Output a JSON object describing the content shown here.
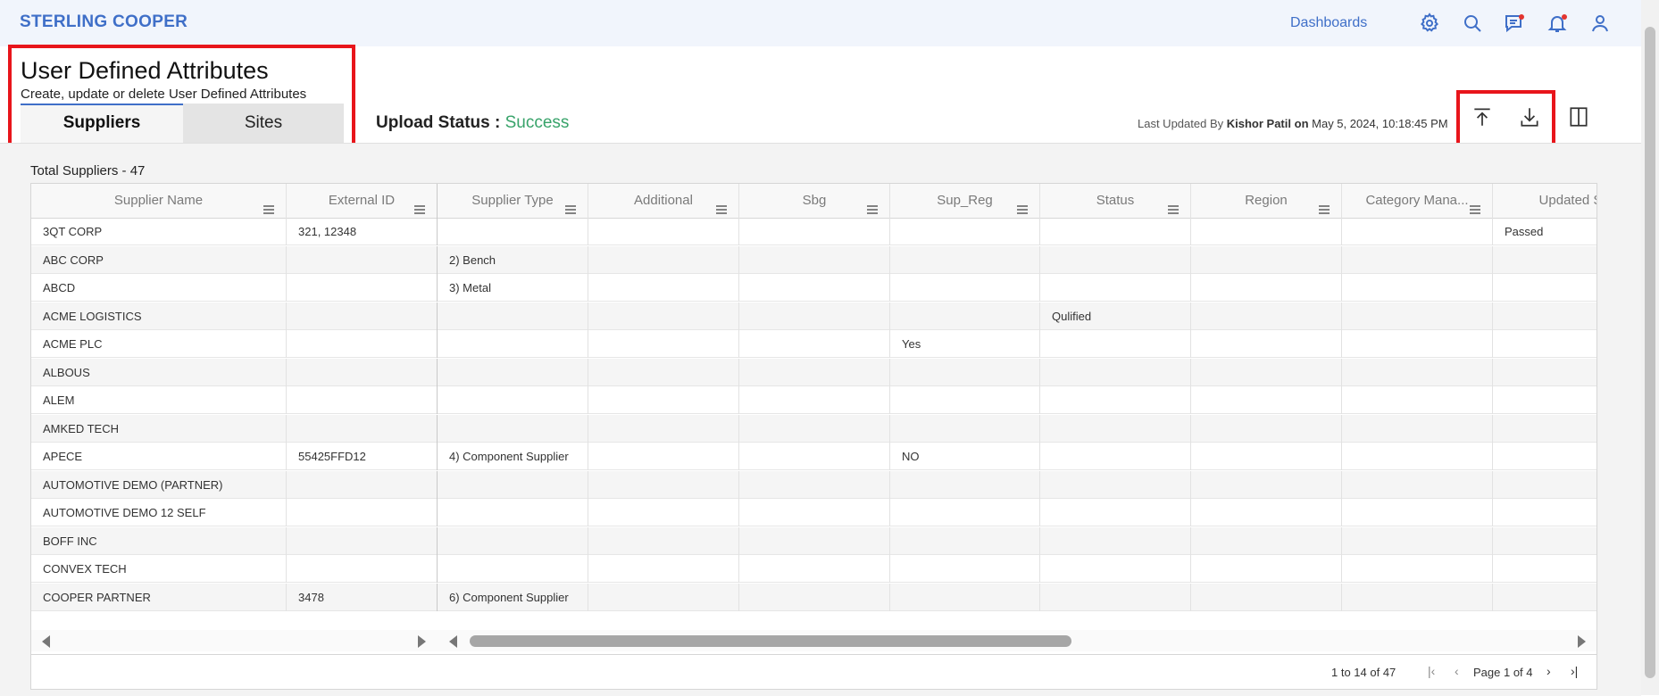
{
  "app": {
    "brand": "STERLING COOPER",
    "nav_link": "Dashboards"
  },
  "topbar_icons": [
    "gear-icon",
    "search-icon",
    "chat-icon",
    "bell-icon",
    "user-icon"
  ],
  "page": {
    "title": "User Defined Attributes",
    "subtitle": "Create, update or delete User Defined Attributes"
  },
  "tabs": [
    {
      "label": "Suppliers",
      "active": true
    },
    {
      "label": "Sites",
      "active": false
    }
  ],
  "upload": {
    "label": "Upload Status :",
    "value": "Success"
  },
  "last_updated": {
    "prefix": "Last Updated By",
    "user": "Kishor Patil",
    "on": "on",
    "timestamp": "May 5, 2024, 10:18:45 PM"
  },
  "actions": [
    "upload-icon",
    "download-icon",
    "columns-panel-icon"
  ],
  "grid": {
    "total_label": "Total Suppliers - 47",
    "columns": [
      "Supplier Name",
      "External ID",
      "Supplier Type",
      "Additional",
      "Sbg",
      "Sup_Reg",
      "Status",
      "Region",
      "Category Mana...",
      "Updated Statu"
    ],
    "rows": [
      [
        "3QT CORP",
        "321, 12348",
        "",
        "",
        "",
        "",
        "",
        "",
        "",
        "Passed"
      ],
      [
        "ABC CORP",
        "",
        "2) Bench",
        "",
        "",
        "",
        "",
        "",
        "",
        ""
      ],
      [
        "ABCD",
        "",
        "3) Metal",
        "",
        "",
        "",
        "",
        "",
        "",
        ""
      ],
      [
        "ACME LOGISTICS",
        "",
        "",
        "",
        "",
        "",
        "Qulified",
        "",
        "",
        ""
      ],
      [
        "ACME PLC",
        "",
        "",
        "",
        "",
        "Yes",
        "",
        "",
        "",
        ""
      ],
      [
        "ALBOUS",
        "",
        "",
        "",
        "",
        "",
        "",
        "",
        "",
        ""
      ],
      [
        "ALEM",
        "",
        "",
        "",
        "",
        "",
        "",
        "",
        "",
        ""
      ],
      [
        "AMKED TECH",
        "",
        "",
        "",
        "",
        "",
        "",
        "",
        "",
        ""
      ],
      [
        "APECE",
        "55425FFD12",
        "4) Component Supplier",
        "",
        "",
        "NO",
        "",
        "",
        "",
        ""
      ],
      [
        "AUTOMOTIVE DEMO (PARTNER)",
        "",
        "",
        "",
        "",
        "",
        "",
        "",
        "",
        ""
      ],
      [
        "AUTOMOTIVE DEMO 12 SELF",
        "",
        "",
        "",
        "",
        "",
        "",
        "",
        "",
        ""
      ],
      [
        "BOFF INC",
        "",
        "",
        "",
        "",
        "",
        "",
        "",
        "",
        ""
      ],
      [
        "CONVEX TECH",
        "",
        "",
        "",
        "",
        "",
        "",
        "",
        "",
        ""
      ],
      [
        "COOPER PARTNER",
        "3478",
        "6) Component Supplier",
        "",
        "",
        "",
        "",
        "",
        "",
        ""
      ]
    ]
  },
  "pager": {
    "count": "1 to 14 of 47",
    "page": "Page 1 of 4"
  },
  "colors": {
    "brand": "#3f6fc8",
    "success": "#38a36a",
    "highlight": "#e8151b"
  }
}
